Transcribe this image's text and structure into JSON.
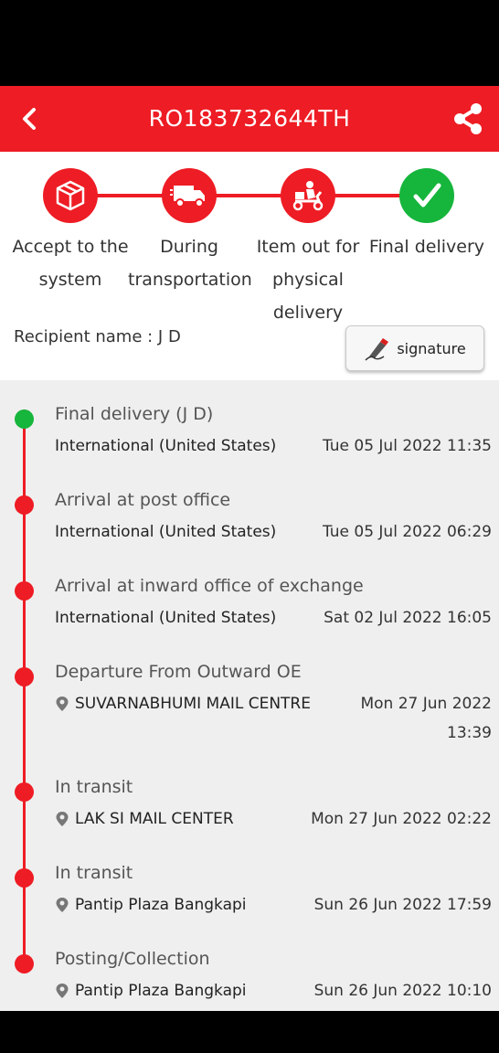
{
  "header": {
    "title": "RO183732644TH"
  },
  "colors": {
    "accent": "#ee1c24",
    "success": "#16b53c"
  },
  "steps": [
    {
      "label": "Accept to the system",
      "icon": "package-icon"
    },
    {
      "label": "During transportation",
      "icon": "truck-icon"
    },
    {
      "label": "Item out for physical delivery",
      "icon": "scooter-icon"
    },
    {
      "label": "Final delivery",
      "icon": "checkmark-icon"
    }
  ],
  "recipient": {
    "text": "Recipient name : J D"
  },
  "signature_button": {
    "label": "signature"
  },
  "events": [
    {
      "status": "Final delivery (J D)",
      "location": "International (United States)",
      "datetime": "Tue 05 Jul 2022 11:35"
    },
    {
      "status": "Arrival at post office",
      "location": "International (United States)",
      "datetime": "Tue 05 Jul 2022 06:29"
    },
    {
      "status": "Arrival at inward office of exchange",
      "location": "International (United States)",
      "datetime": "Sat 02 Jul 2022 16:05"
    },
    {
      "status": "Departure From Outward OE",
      "location": "SUVARNABHUMI MAIL CENTRE",
      "datetime": "Mon 27 Jun 2022 13:39"
    },
    {
      "status": "In transit",
      "location": "LAK SI MAIL CENTER",
      "datetime": "Mon 27 Jun 2022 02:22"
    },
    {
      "status": "In transit",
      "location": "Pantip Plaza Bangkapi",
      "datetime": "Sun 26 Jun 2022 17:59"
    },
    {
      "status": "Posting/Collection",
      "location": "Pantip Plaza Bangkapi",
      "datetime": "Sun 26 Jun 2022 10:10"
    }
  ]
}
